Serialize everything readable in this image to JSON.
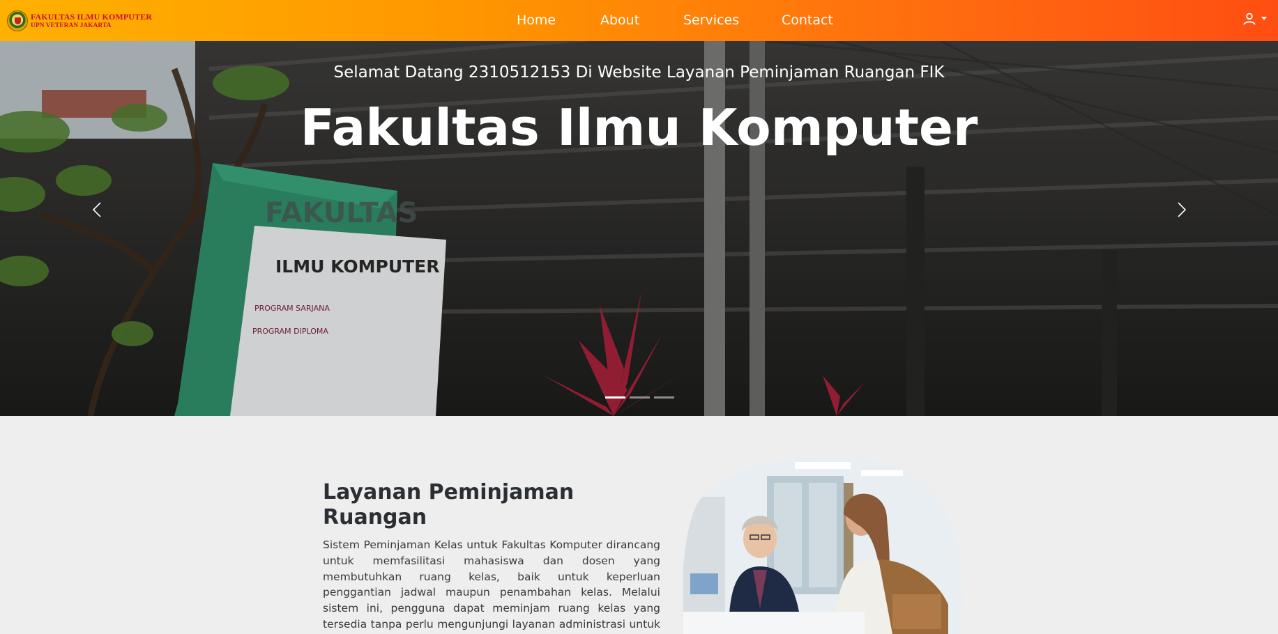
{
  "navbar": {
    "brand_line1": "FAKULTAS ILMU KOMPUTER",
    "brand_line2": "UPN VETERAN JAKARTA",
    "links": [
      "Home",
      "About",
      "Services",
      "Contact"
    ]
  },
  "hero": {
    "subtitle": "Selamat Datang 2310512153 Di Website Layanan Peminjaman Ruangan FIK",
    "title": "Fakultas Ilmu Komputer",
    "sign_title": "ILMU KOMPUTER",
    "sign_top": "FAKULTAS",
    "sign_line1": "PROGRAM SARJANA",
    "sign_line2": "PROGRAM DIPLOMA",
    "slide_count": 3,
    "active_slide": 1
  },
  "about": {
    "heading": "Layanan Peminjaman Ruangan",
    "body": "Sistem Peminjaman Kelas untuk Fakultas Komputer dirancang untuk memfasilitasi mahasiswa dan dosen yang membutuhkan ruang kelas, baik untuk keperluan penggantian jadwal maupun penambahan kelas. Melalui sistem ini, pengguna dapat meminjam ruang kelas yang tersedia tanpa perlu mengunjungi layanan administrasi untuk memeriksa"
  },
  "colors": {
    "nav_gradient_start": "#ffb100",
    "nav_gradient_end": "#ff4e12",
    "brand_text": "#c8102e",
    "section_bg": "#eeeeee"
  },
  "icons": [
    "user-icon",
    "chevron-left-icon",
    "chevron-right-icon"
  ]
}
